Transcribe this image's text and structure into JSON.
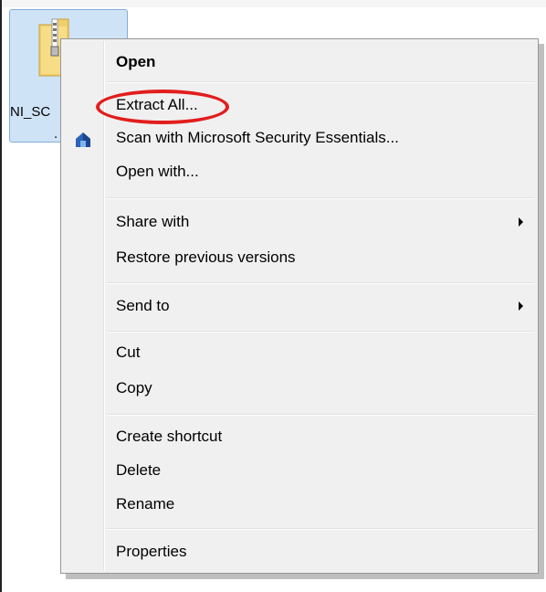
{
  "file": {
    "name_line1": "NI_SC",
    "name_line2": ".",
    "icon": "zip-folder-icon"
  },
  "context_menu": {
    "items": [
      {
        "label": "Open",
        "bold": true
      },
      {
        "label": "Extract All..."
      },
      {
        "label": "Scan with Microsoft Security Essentials...",
        "icon": "security-essentials-icon"
      },
      {
        "label": "Open with..."
      },
      {
        "label": "Share with",
        "submenu": true
      },
      {
        "label": "Restore previous versions"
      },
      {
        "label": "Send to",
        "submenu": true
      },
      {
        "label": "Cut"
      },
      {
        "label": "Copy"
      },
      {
        "label": "Create shortcut"
      },
      {
        "label": "Delete"
      },
      {
        "label": "Rename"
      },
      {
        "label": "Properties"
      }
    ]
  },
  "annotation": {
    "highlighted_item": "Extract All...",
    "color": "#e21d1d"
  }
}
